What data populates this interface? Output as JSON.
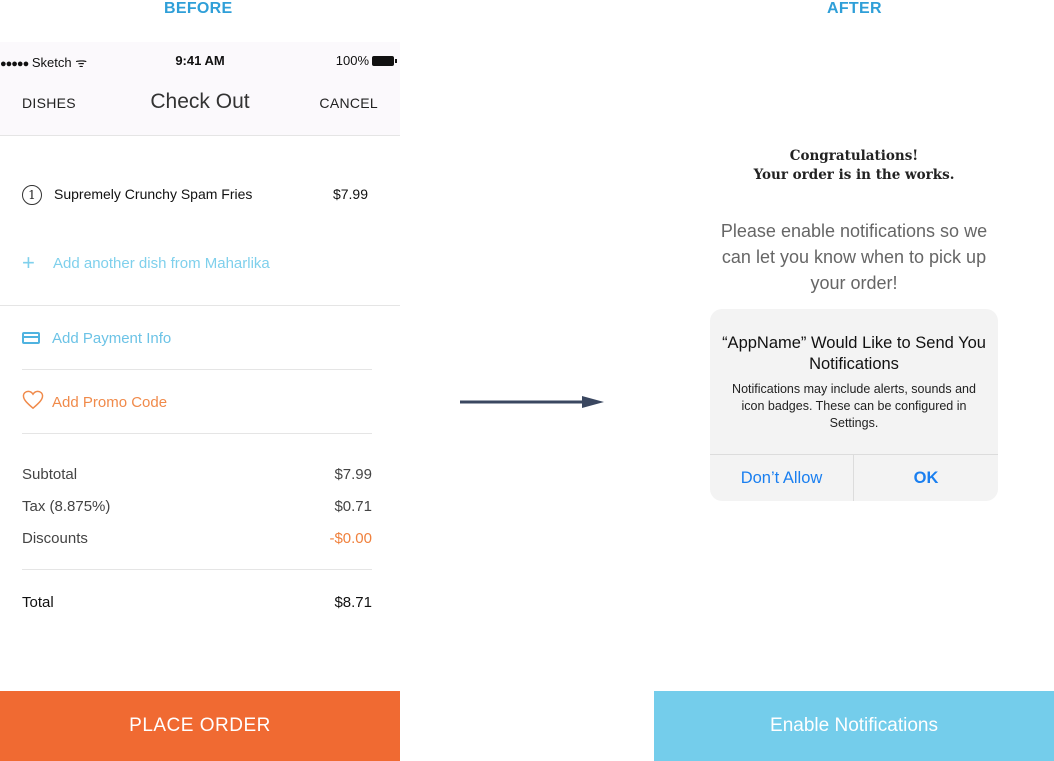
{
  "labels": {
    "before": "BEFORE",
    "after": "AFTER"
  },
  "status_bar": {
    "signal": "●●●●●",
    "carrier": "Sketch",
    "wifi_glyph": "ᯤ",
    "time": "9:41 AM",
    "battery": "100%"
  },
  "nav": {
    "left": "DISHES",
    "title": "Check Out",
    "right": "CANCEL"
  },
  "order": {
    "item": {
      "qty": "1",
      "name": "Supremely Crunchy Spam Fries",
      "price": "$7.99"
    },
    "add_dish": "Add another dish from Maharlika",
    "add_payment": "Add Payment Info",
    "add_promo": "Add Promo Code"
  },
  "summary": {
    "subtotal_label": "Subtotal",
    "subtotal": "$7.99",
    "tax_label": "Tax (8.875%)",
    "tax": "$0.71",
    "discounts_label": "Discounts",
    "discounts": "-$0.00",
    "total_label": "Total",
    "total": "$8.71"
  },
  "place_order": "PLACE ORDER",
  "after": {
    "congrats_line1": "Congratulations!",
    "congrats_line2": "Your order is in the works.",
    "notif_prompt": "Please enable notifications so we can let you know when to pick up your order!",
    "alert": {
      "title": "“AppName” Would Like to Send You Notifications",
      "body": "Notifications may include alerts, sounds and icon badges. These can be configured in Settings.",
      "deny": "Don’t Allow",
      "ok": "OK"
    },
    "enable_button": "Enable Notifications"
  },
  "colors": {
    "accent_orange": "#f06a32",
    "accent_blue": "#74cdeb",
    "label_blue": "#2f9fd8",
    "ios_blue": "#1a7ff0"
  }
}
